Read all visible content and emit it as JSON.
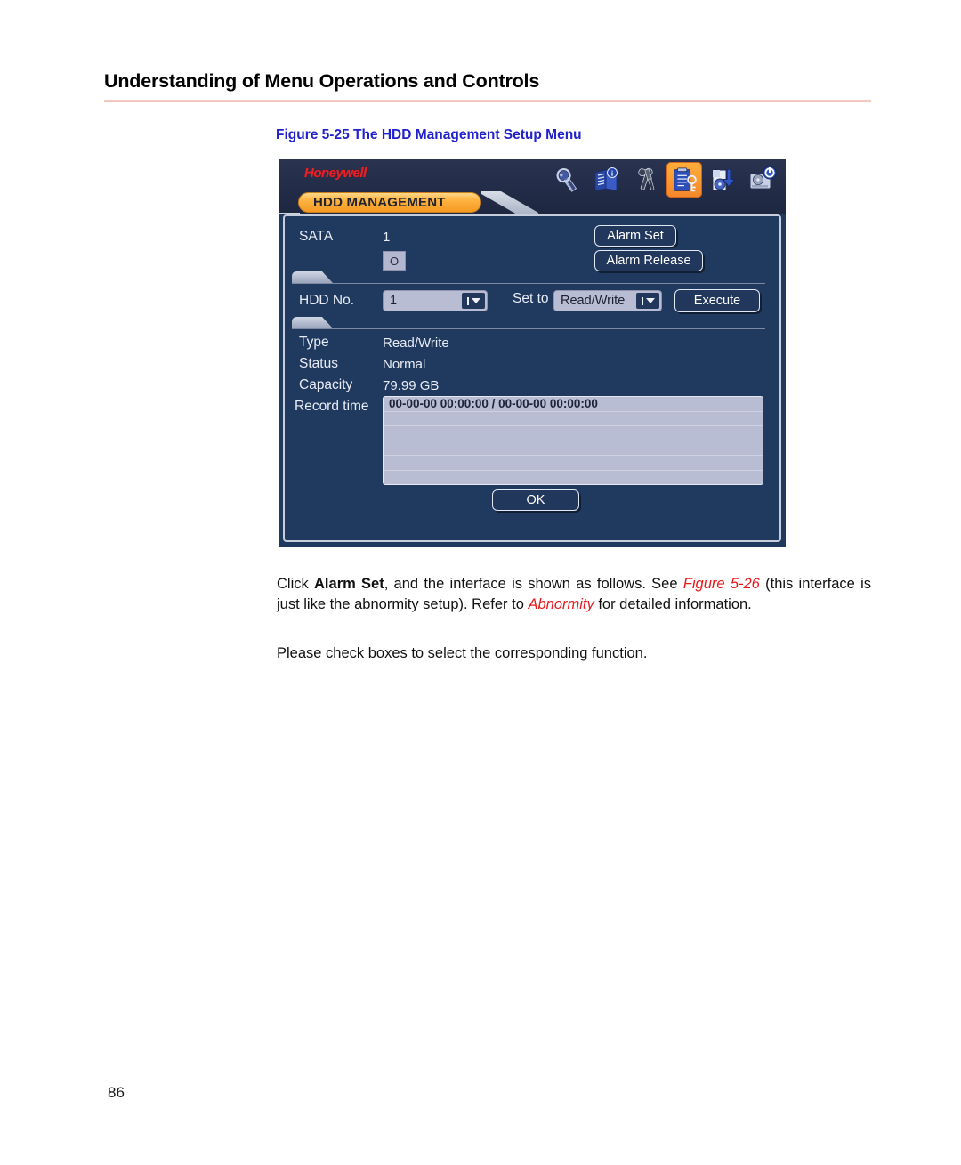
{
  "page": {
    "title": "Understanding of Menu Operations and Controls",
    "figure_caption": "Figure 5-25 The HDD Management Setup Menu",
    "page_number": "86",
    "rule_color": "#f6c6c0",
    "caption_color": "#2222cc"
  },
  "body": {
    "para1_part1": "Click ",
    "para1_bold": "Alarm Set",
    "para1_part2": ", and the interface is shown as follows. See ",
    "para1_ref1": "Figure 5-26",
    "para1_part3": " (this interface is just like the abnormity setup). Refer to ",
    "para1_ref2": "Abnormity",
    "para1_part4": " for detailed information.",
    "para2": "Please check boxes to select the corresponding function."
  },
  "dvr": {
    "brand": "Honeywell",
    "brand_color": "#ec2024",
    "accent_color": "#ffb443",
    "panel_color": "#20395f",
    "tab_label": "HDD MANAGEMENT",
    "toolbar_icons": [
      {
        "name": "search-icon",
        "selected": false
      },
      {
        "name": "info-book-icon",
        "selected": false
      },
      {
        "name": "tools-icon",
        "selected": false
      },
      {
        "name": "hdd-management-clipboard-icon",
        "selected": true
      },
      {
        "name": "backup-disc-icon",
        "selected": false
      },
      {
        "name": "shutdown-drive-icon",
        "selected": false
      }
    ],
    "sata": {
      "label": "SATA",
      "value": "1",
      "indicator": "O"
    },
    "buttons": {
      "alarm_set": "Alarm Set",
      "alarm_release": "Alarm Release",
      "execute": "Execute",
      "ok": "OK"
    },
    "hdd_no": {
      "label": "HDD No.",
      "value": "1"
    },
    "set_to": {
      "label": "Set to",
      "value": "Read/Write"
    },
    "details": {
      "type_label": "Type",
      "type_value": "Read/Write",
      "status_label": "Status",
      "status_value": "Normal",
      "capacity_label": "Capacity",
      "capacity_value": "79.99 GB",
      "record_time_label": "Record time"
    },
    "record_time_rows": [
      "00-00-00 00:00:00 / 00-00-00 00:00:00",
      "",
      "",
      "",
      "",
      ""
    ]
  }
}
